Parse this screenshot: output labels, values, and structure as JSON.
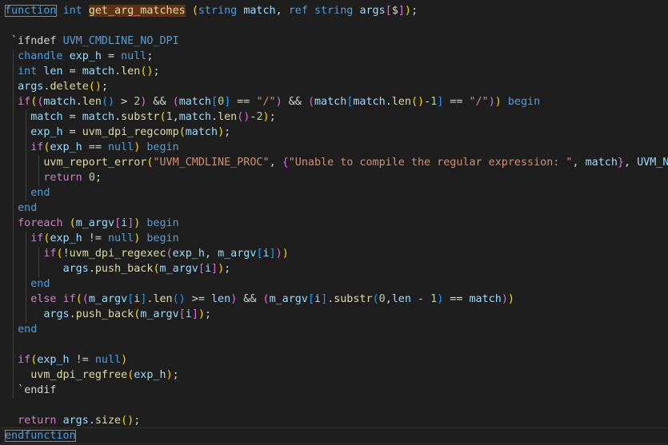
{
  "editor": {
    "language": "systemverilog",
    "colors": {
      "background": "#1e1e1e",
      "keyword": "#569cd6",
      "control": "#c586c0",
      "identifier": "#9cdcfe",
      "function": "#dcdcaa",
      "string": "#ce9178",
      "number": "#b5cea8",
      "bracket_1": "#ffd700",
      "bracket_2": "#da70d6",
      "bracket_3": "#179fff",
      "highlight": "#613214"
    },
    "lines": [
      {
        "tokens": [
          {
            "t": "function",
            "c": "kw boxed"
          },
          {
            "t": " "
          },
          {
            "t": "int",
            "c": "kw"
          },
          {
            "t": " "
          },
          {
            "t": "get_arg_matches",
            "c": "fn hl"
          },
          {
            "t": " "
          },
          {
            "t": "(",
            "c": "b1"
          },
          {
            "t": "string",
            "c": "kw"
          },
          {
            "t": " "
          },
          {
            "t": "match",
            "c": "id"
          },
          {
            "t": ", "
          },
          {
            "t": "ref",
            "c": "kw"
          },
          {
            "t": " "
          },
          {
            "t": "string",
            "c": "kw"
          },
          {
            "t": " "
          },
          {
            "t": "args",
            "c": "id"
          },
          {
            "t": "[",
            "c": "b2"
          },
          {
            "t": "$"
          },
          {
            "t": "]",
            "c": "b2"
          },
          {
            "t": ")",
            "c": "b1"
          },
          {
            "t": ";"
          }
        ]
      },
      {
        "tokens": []
      },
      {
        "tokens": [
          {
            "t": " `"
          },
          {
            "t": "ifndef",
            "c": "op"
          },
          {
            "t": " "
          },
          {
            "t": "UVM_CMDLINE_NO_DPI",
            "c": "kw"
          }
        ]
      },
      {
        "tokens": [
          {
            "t": "  "
          },
          {
            "t": "chandle",
            "c": "kw"
          },
          {
            "t": " "
          },
          {
            "t": "exp_h",
            "c": "id"
          },
          {
            "t": " = "
          },
          {
            "t": "null",
            "c": "kw"
          },
          {
            "t": ";"
          }
        ]
      },
      {
        "tokens": [
          {
            "t": "  "
          },
          {
            "t": "int",
            "c": "kw"
          },
          {
            "t": " "
          },
          {
            "t": "len",
            "c": "id"
          },
          {
            "t": " = "
          },
          {
            "t": "match",
            "c": "id"
          },
          {
            "t": "."
          },
          {
            "t": "len",
            "c": "fn"
          },
          {
            "t": "()",
            "c": "b1"
          },
          {
            "t": ";"
          }
        ]
      },
      {
        "tokens": [
          {
            "t": "  "
          },
          {
            "t": "args",
            "c": "id"
          },
          {
            "t": "."
          },
          {
            "t": "delete",
            "c": "fn"
          },
          {
            "t": "()",
            "c": "b1"
          },
          {
            "t": ";"
          }
        ]
      },
      {
        "tokens": [
          {
            "t": "  "
          },
          {
            "t": "if",
            "c": "ctl"
          },
          {
            "t": "(",
            "c": "b1"
          },
          {
            "t": "(",
            "c": "b2"
          },
          {
            "t": "match",
            "c": "id"
          },
          {
            "t": "."
          },
          {
            "t": "len",
            "c": "fn"
          },
          {
            "t": "()",
            "c": "b3"
          },
          {
            "t": " > "
          },
          {
            "t": "2",
            "c": "num"
          },
          {
            "t": ")",
            "c": "b2"
          },
          {
            "t": " && "
          },
          {
            "t": "(",
            "c": "b2"
          },
          {
            "t": "match",
            "c": "id"
          },
          {
            "t": "[",
            "c": "b3"
          },
          {
            "t": "0",
            "c": "num"
          },
          {
            "t": "]",
            "c": "b3"
          },
          {
            "t": " == "
          },
          {
            "t": "\"/\"",
            "c": "str"
          },
          {
            "t": ")",
            "c": "b2"
          },
          {
            "t": " && "
          },
          {
            "t": "(",
            "c": "b2"
          },
          {
            "t": "match",
            "c": "id"
          },
          {
            "t": "[",
            "c": "b3"
          },
          {
            "t": "match",
            "c": "id"
          },
          {
            "t": "."
          },
          {
            "t": "len",
            "c": "fn"
          },
          {
            "t": "()",
            "c": "b1"
          },
          {
            "t": "-"
          },
          {
            "t": "1",
            "c": "num"
          },
          {
            "t": "]",
            "c": "b3"
          },
          {
            "t": " == "
          },
          {
            "t": "\"/\"",
            "c": "str"
          },
          {
            "t": ")",
            "c": "b2"
          },
          {
            "t": ")",
            "c": "b1"
          },
          {
            "t": " "
          },
          {
            "t": "begin",
            "c": "kw"
          }
        ]
      },
      {
        "tokens": [
          {
            "t": "    "
          },
          {
            "t": "match",
            "c": "id"
          },
          {
            "t": " = "
          },
          {
            "t": "match",
            "c": "id"
          },
          {
            "t": "."
          },
          {
            "t": "substr",
            "c": "fn"
          },
          {
            "t": "(",
            "c": "b1"
          },
          {
            "t": "1",
            "c": "num"
          },
          {
            "t": ","
          },
          {
            "t": "match",
            "c": "id"
          },
          {
            "t": "."
          },
          {
            "t": "len",
            "c": "fn"
          },
          {
            "t": "()",
            "c": "b2"
          },
          {
            "t": "-"
          },
          {
            "t": "2",
            "c": "num"
          },
          {
            "t": ")",
            "c": "b1"
          },
          {
            "t": ";"
          }
        ]
      },
      {
        "tokens": [
          {
            "t": "    "
          },
          {
            "t": "exp_h",
            "c": "id"
          },
          {
            "t": " = "
          },
          {
            "t": "uvm_dpi_regcomp",
            "c": "fn"
          },
          {
            "t": "(",
            "c": "b1"
          },
          {
            "t": "match",
            "c": "id"
          },
          {
            "t": ")",
            "c": "b1"
          },
          {
            "t": ";"
          }
        ]
      },
      {
        "tokens": [
          {
            "t": "    "
          },
          {
            "t": "if",
            "c": "ctl"
          },
          {
            "t": "(",
            "c": "b1"
          },
          {
            "t": "exp_h",
            "c": "id"
          },
          {
            "t": " == "
          },
          {
            "t": "null",
            "c": "kw"
          },
          {
            "t": ")",
            "c": "b1"
          },
          {
            "t": " "
          },
          {
            "t": "begin",
            "c": "kw"
          }
        ]
      },
      {
        "tokens": [
          {
            "t": "      "
          },
          {
            "t": "uvm_report_error",
            "c": "fn"
          },
          {
            "t": "(",
            "c": "b1"
          },
          {
            "t": "\"UVM_CMDLINE_PROC\"",
            "c": "str"
          },
          {
            "t": ", "
          },
          {
            "t": "{",
            "c": "b2"
          },
          {
            "t": "\"Unable to compile the regular expression: \"",
            "c": "str"
          },
          {
            "t": ", "
          },
          {
            "t": "match",
            "c": "id"
          },
          {
            "t": "}",
            "c": "b2"
          },
          {
            "t": ", "
          },
          {
            "t": "UVM_NONE",
            "c": "id"
          },
          {
            "t": ")",
            "c": "b1"
          },
          {
            "t": ";"
          }
        ]
      },
      {
        "tokens": [
          {
            "t": "      "
          },
          {
            "t": "return",
            "c": "ctl"
          },
          {
            "t": " "
          },
          {
            "t": "0",
            "c": "num"
          },
          {
            "t": ";"
          }
        ]
      },
      {
        "tokens": [
          {
            "t": "    "
          },
          {
            "t": "end",
            "c": "kw"
          }
        ]
      },
      {
        "tokens": [
          {
            "t": "  "
          },
          {
            "t": "end",
            "c": "kw"
          }
        ]
      },
      {
        "tokens": [
          {
            "t": "  "
          },
          {
            "t": "foreach",
            "c": "ctl"
          },
          {
            "t": " "
          },
          {
            "t": "(",
            "c": "b1"
          },
          {
            "t": "m_argv",
            "c": "id"
          },
          {
            "t": "[",
            "c": "b2"
          },
          {
            "t": "i",
            "c": "id"
          },
          {
            "t": "]",
            "c": "b2"
          },
          {
            "t": ")",
            "c": "b1"
          },
          {
            "t": " "
          },
          {
            "t": "begin",
            "c": "kw"
          }
        ]
      },
      {
        "tokens": [
          {
            "t": "    "
          },
          {
            "t": "if",
            "c": "ctl"
          },
          {
            "t": "(",
            "c": "b1"
          },
          {
            "t": "exp_h",
            "c": "id"
          },
          {
            "t": " != "
          },
          {
            "t": "null",
            "c": "kw"
          },
          {
            "t": ")",
            "c": "b1"
          },
          {
            "t": " "
          },
          {
            "t": "begin",
            "c": "kw"
          }
        ]
      },
      {
        "tokens": [
          {
            "t": "      "
          },
          {
            "t": "if",
            "c": "ctl"
          },
          {
            "t": "(",
            "c": "b1"
          },
          {
            "t": "!"
          },
          {
            "t": "uvm_dpi_regexec",
            "c": "fn"
          },
          {
            "t": "(",
            "c": "b2"
          },
          {
            "t": "exp_h",
            "c": "id"
          },
          {
            "t": ", "
          },
          {
            "t": "m_argv",
            "c": "id"
          },
          {
            "t": "[",
            "c": "b3"
          },
          {
            "t": "i",
            "c": "id"
          },
          {
            "t": "]",
            "c": "b3"
          },
          {
            "t": ")",
            "c": "b2"
          },
          {
            "t": ")",
            "c": "b1"
          }
        ]
      },
      {
        "tokens": [
          {
            "t": "         "
          },
          {
            "t": "args",
            "c": "id"
          },
          {
            "t": "."
          },
          {
            "t": "push_back",
            "c": "fn"
          },
          {
            "t": "(",
            "c": "b1"
          },
          {
            "t": "m_argv",
            "c": "id"
          },
          {
            "t": "[",
            "c": "b2"
          },
          {
            "t": "i",
            "c": "id"
          },
          {
            "t": "]",
            "c": "b2"
          },
          {
            "t": ")",
            "c": "b1"
          },
          {
            "t": ";"
          }
        ]
      },
      {
        "tokens": [
          {
            "t": "    "
          },
          {
            "t": "end",
            "c": "kw"
          }
        ]
      },
      {
        "tokens": [
          {
            "t": "    "
          },
          {
            "t": "else",
            "c": "ctl"
          },
          {
            "t": " "
          },
          {
            "t": "if",
            "c": "ctl"
          },
          {
            "t": "(",
            "c": "b1"
          },
          {
            "t": "(",
            "c": "b2"
          },
          {
            "t": "m_argv",
            "c": "id"
          },
          {
            "t": "[",
            "c": "b3"
          },
          {
            "t": "i",
            "c": "id"
          },
          {
            "t": "]",
            "c": "b3"
          },
          {
            "t": "."
          },
          {
            "t": "len",
            "c": "fn"
          },
          {
            "t": "()",
            "c": "b3"
          },
          {
            "t": " >= "
          },
          {
            "t": "len",
            "c": "id"
          },
          {
            "t": ")",
            "c": "b2"
          },
          {
            "t": " && "
          },
          {
            "t": "(",
            "c": "b2"
          },
          {
            "t": "m_argv",
            "c": "id"
          },
          {
            "t": "[",
            "c": "b3"
          },
          {
            "t": "i",
            "c": "id"
          },
          {
            "t": "]",
            "c": "b3"
          },
          {
            "t": "."
          },
          {
            "t": "substr",
            "c": "fn"
          },
          {
            "t": "(",
            "c": "b3"
          },
          {
            "t": "0",
            "c": "num"
          },
          {
            "t": ","
          },
          {
            "t": "len",
            "c": "id"
          },
          {
            "t": " - "
          },
          {
            "t": "1",
            "c": "num"
          },
          {
            "t": ")",
            "c": "b3"
          },
          {
            "t": " == "
          },
          {
            "t": "match",
            "c": "id"
          },
          {
            "t": ")",
            "c": "b2"
          },
          {
            "t": ")",
            "c": "b1"
          }
        ]
      },
      {
        "tokens": [
          {
            "t": "      "
          },
          {
            "t": "args",
            "c": "id"
          },
          {
            "t": "."
          },
          {
            "t": "push_back",
            "c": "fn"
          },
          {
            "t": "(",
            "c": "b1"
          },
          {
            "t": "m_argv",
            "c": "id"
          },
          {
            "t": "[",
            "c": "b2"
          },
          {
            "t": "i",
            "c": "id"
          },
          {
            "t": "]",
            "c": "b2"
          },
          {
            "t": ")",
            "c": "b1"
          },
          {
            "t": ";"
          }
        ]
      },
      {
        "tokens": [
          {
            "t": "  "
          },
          {
            "t": "end",
            "c": "kw"
          }
        ]
      },
      {
        "tokens": []
      },
      {
        "tokens": [
          {
            "t": "  "
          },
          {
            "t": "if",
            "c": "ctl"
          },
          {
            "t": "(",
            "c": "b1"
          },
          {
            "t": "exp_h",
            "c": "id"
          },
          {
            "t": " != "
          },
          {
            "t": "null",
            "c": "kw"
          },
          {
            "t": ")",
            "c": "b1"
          }
        ]
      },
      {
        "tokens": [
          {
            "t": "    "
          },
          {
            "t": "uvm_dpi_regfree",
            "c": "fn"
          },
          {
            "t": "(",
            "c": "b1"
          },
          {
            "t": "exp_h",
            "c": "id"
          },
          {
            "t": ")",
            "c": "b1"
          },
          {
            "t": ";"
          }
        ]
      },
      {
        "tokens": [
          {
            "t": "  `"
          },
          {
            "t": "endif",
            "c": "op"
          }
        ]
      },
      {
        "tokens": []
      },
      {
        "tokens": [
          {
            "t": "  "
          },
          {
            "t": "return",
            "c": "ctl"
          },
          {
            "t": " "
          },
          {
            "t": "args",
            "c": "id"
          },
          {
            "t": "."
          },
          {
            "t": "size",
            "c": "fn"
          },
          {
            "t": "()",
            "c": "b1"
          },
          {
            "t": ";"
          }
        ]
      },
      {
        "tokens": [
          {
            "t": "endfunction",
            "c": "kw boxed"
          }
        ]
      }
    ]
  }
}
